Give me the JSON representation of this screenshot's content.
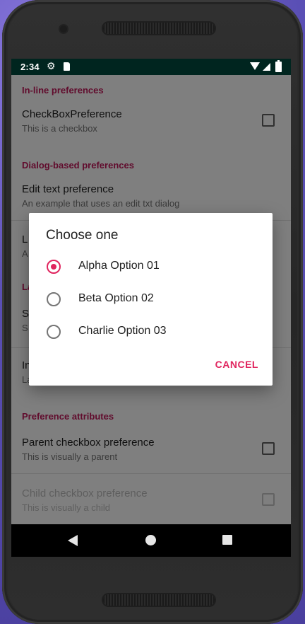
{
  "status_bar": {
    "time": "2:34",
    "icons": [
      "gear-icon",
      "sd-card-icon",
      "wifi-icon",
      "signal-icon",
      "battery-icon"
    ]
  },
  "preferences": {
    "sections": [
      {
        "title": "In-line preferences",
        "items": [
          {
            "title": "CheckBoxPreference",
            "summary": "This is a checkbox",
            "widget": "checkbox"
          }
        ]
      },
      {
        "title": "Dialog-based preferences",
        "items": [
          {
            "title": "Edit text preference",
            "summary": "An example that uses an edit txt dialog"
          },
          {
            "title": "L",
            "summary": "A"
          }
        ]
      },
      {
        "title": "La",
        "items": [
          {
            "title": "S",
            "summary": "S"
          },
          {
            "title": "In",
            "summary": "La"
          }
        ]
      },
      {
        "title": "Preference attributes",
        "items": [
          {
            "title": "Parent checkbox preference",
            "summary": "This is visually a parent",
            "widget": "checkbox"
          },
          {
            "title": "Child checkbox preference",
            "summary": "This is visually a child",
            "widget": "checkbox",
            "enabled": false
          }
        ]
      }
    ]
  },
  "dialog": {
    "title": "Choose one",
    "options": [
      {
        "label": "Alpha Option 01",
        "selected": true
      },
      {
        "label": "Beta Option 02",
        "selected": false
      },
      {
        "label": "Charlie Option 03",
        "selected": false
      }
    ],
    "cancel_label": "CANCEL"
  },
  "nav_bar": {
    "icons": [
      "back-icon",
      "home-icon",
      "recents-icon"
    ]
  },
  "colors": {
    "accent": "#e0245e",
    "section_title": "#c2185b",
    "status_bar": "#00251f"
  }
}
